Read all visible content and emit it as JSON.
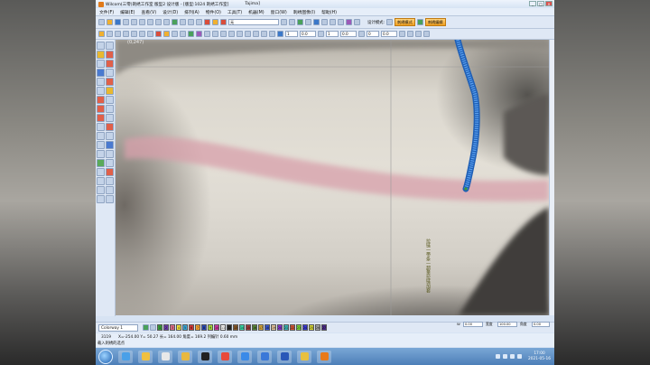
{
  "window": {
    "title": "Wilcom(三零)刺绣工作室 版型2 设计版 - [版型:1024 刺绣工作室]",
    "title_right": "Tajima]",
    "controls": [
      "_",
      "□",
      "×"
    ]
  },
  "menu": [
    "文件(F)",
    "编辑(E)",
    "查看(V)",
    "设计(D)",
    "排列(A)",
    "物件(O)",
    "工具(T)",
    "机器(M)",
    "窗口(W)",
    "刺绣图像(I)",
    "帮助(H)"
  ],
  "toolbar1": {
    "font_field": "无",
    "design_mode_label": "设计模式:",
    "mode_button": "刺绣模式",
    "cn_button": "刺绣编辑"
  },
  "toolbar2": {
    "field_a": "1",
    "field_b": "0.0",
    "field_c": "1",
    "field_d": "0.0",
    "field_e": "0",
    "field_f": "0.0"
  },
  "canvas": {
    "coordinate": "(0,247)",
    "annotation_text": "拉链一带条一超量拉链加套"
  },
  "palette": {
    "colorway": "Colorway 1",
    "swatches": [
      {
        "n": "1",
        "c": "#3a9a3a"
      },
      {
        "n": "2",
        "c": "#6a3aa8"
      },
      {
        "n": "3",
        "c": "#e06f8a"
      },
      {
        "n": "4",
        "c": "#f2e33a"
      },
      {
        "n": "5",
        "c": "#3aa8d8"
      },
      {
        "n": "6",
        "c": "#d43a3a"
      },
      {
        "n": "7",
        "c": "#f2a030"
      },
      {
        "n": "8",
        "c": "#2a4ab8"
      },
      {
        "n": "9",
        "c": "#a8d83a"
      },
      {
        "n": "10",
        "c": "#d83aa8"
      },
      {
        "n": "11",
        "c": "#fafafa"
      },
      {
        "n": "12",
        "c": "#2a2a2a"
      },
      {
        "n": "13",
        "c": "#8a5a2a"
      },
      {
        "n": "14",
        "c": "#3ad8a8"
      },
      {
        "n": "15",
        "c": "#a83a3a"
      },
      {
        "n": "16",
        "c": "#5a8a3a"
      },
      {
        "n": "17",
        "c": "#d8a83a"
      },
      {
        "n": "18",
        "c": "#3a5ad8"
      },
      {
        "n": "19",
        "c": "#e8c8a0"
      },
      {
        "n": "20",
        "c": "#8a3ad8"
      },
      {
        "n": "21",
        "c": "#3ab8b8"
      },
      {
        "n": "22",
        "c": "#d85a3a"
      },
      {
        "n": "23",
        "c": "#7ad83a"
      },
      {
        "n": "24",
        "c": "#3a3ad8"
      },
      {
        "n": "25",
        "c": "#d8d83a"
      },
      {
        "n": "26",
        "c": "#a8a8a8"
      },
      {
        "n": "27",
        "c": "#4a2a8a"
      }
    ],
    "readouts": [
      {
        "label": "W",
        "value": "0.00"
      },
      {
        "label": "H",
        "value": "0.00"
      },
      {
        "label": "宽度",
        "value": "100.00"
      },
      {
        "label": "高度",
        "value": "100.00"
      },
      {
        "label": "角度",
        "value": "0.00"
      },
      {
        "label": "角度",
        "value": "0.00"
      }
    ]
  },
  "status": {
    "stitches": "3119",
    "position": "X=-254.00  Y= 50.27  长= 164.00  角度= 169.2  列编针  0.60 mm",
    "hint": "载入刺绣的选点"
  },
  "taskbar": {
    "time": "17:00",
    "date": "2021-05-16",
    "apps": [
      {
        "name": "ie-app",
        "color": "#4aa0e8"
      },
      {
        "name": "explorer-app",
        "color": "#f0c040"
      },
      {
        "name": "edit-app",
        "color": "#e8e8e8"
      },
      {
        "name": "folder-app",
        "color": "#e8b840"
      },
      {
        "name": "qq-app",
        "color": "#222222"
      },
      {
        "name": "chrome-app",
        "color": "#e84a3a"
      },
      {
        "name": "browser-app",
        "color": "#3a8ae8"
      },
      {
        "name": "feather-app",
        "color": "#3a78d8"
      },
      {
        "name": "shield-app",
        "color": "#2a58b8"
      },
      {
        "name": "award-app",
        "color": "#e8c040"
      },
      {
        "name": "wilcom-app",
        "color": "#e87a1a"
      }
    ]
  },
  "colors": {
    "stitch_blue": "#3a7fd6",
    "pink_band": "#d8a0ab",
    "accent_orange": "#f0a020"
  }
}
